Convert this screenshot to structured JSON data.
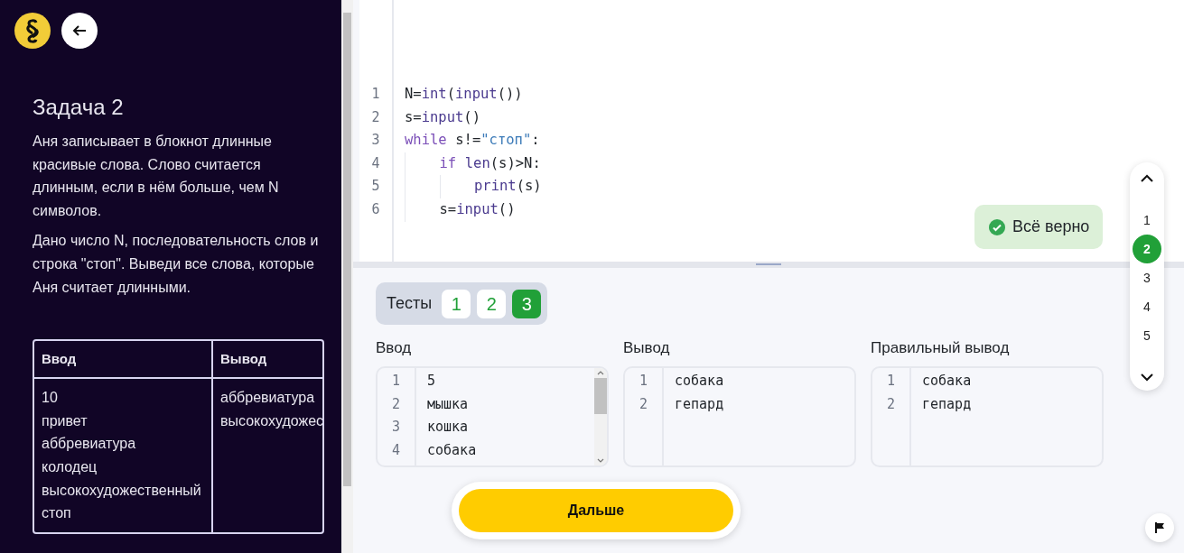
{
  "sidebar": {
    "title": "Задача 2",
    "paragraphs": [
      "Аня записывает в блокнот длинные красивые слова. Слово считается длинным, если в нём больше, чем N символов.",
      "Дано число N, последовательность слов и строка \"стоп\". Выведи все слова, которые Аня считает длинными."
    ],
    "example_table": {
      "columns": [
        "Ввод",
        "Вывод"
      ],
      "rows": [
        [
          [
            "10",
            "привет",
            "аббревиатура",
            "колодец",
            "высокохудожественный",
            "стоп"
          ],
          [
            "аббревиатура",
            "высокохудожес"
          ]
        ]
      ]
    }
  },
  "editor": {
    "lines": [
      {
        "number": "1",
        "tokens": [
          {
            "kind": "plain",
            "text": "N="
          },
          {
            "kind": "builtin",
            "text": "int"
          },
          {
            "kind": "plain",
            "text": "("
          },
          {
            "kind": "builtin",
            "text": "input"
          },
          {
            "kind": "plain",
            "text": "())"
          }
        ]
      },
      {
        "number": "2",
        "tokens": [
          {
            "kind": "plain",
            "text": "s="
          },
          {
            "kind": "builtin",
            "text": "input"
          },
          {
            "kind": "plain",
            "text": "()"
          }
        ]
      },
      {
        "number": "3",
        "tokens": [
          {
            "kind": "keyword",
            "text": "while"
          },
          {
            "kind": "plain",
            "text": "s!=",
            "space_before": true
          },
          {
            "kind": "string",
            "text": "\"стоп\""
          },
          {
            "kind": "plain",
            "text": ":"
          }
        ],
        "children": [
          {
            "number": "4",
            "tokens": [
              {
                "kind": "keyword",
                "text": "if"
              },
              {
                "kind": "builtin",
                "text": "len",
                "space_before": true
              },
              {
                "kind": "plain",
                "text": "(s)>N:"
              }
            ],
            "children": [
              {
                "number": "5",
                "tokens": [
                  {
                    "kind": "builtin",
                    "text": "print"
                  },
                  {
                    "kind": "plain",
                    "text": "(s)"
                  }
                ]
              }
            ]
          },
          {
            "number": "6",
            "tokens": [
              {
                "kind": "plain",
                "text": "s="
              },
              {
                "kind": "builtin",
                "text": "input"
              },
              {
                "kind": "plain",
                "text": "()"
              }
            ]
          }
        ]
      }
    ],
    "status": "Всё верно"
  },
  "task_nav": [
    {
      "label": "1",
      "selected": false
    },
    {
      "label": "2",
      "selected": true
    },
    {
      "label": "3",
      "selected": false
    },
    {
      "label": "4",
      "selected": false
    },
    {
      "label": "5",
      "selected": false
    }
  ],
  "tests": {
    "label": "Тесты",
    "items": [
      {
        "label": "1",
        "selected": false
      },
      {
        "label": "2",
        "selected": false
      },
      {
        "label": "3",
        "selected": true
      }
    ]
  },
  "panels": [
    {
      "title": "Ввод",
      "lines": [
        {
          "number": "1",
          "text": "5"
        },
        {
          "number": "2",
          "text": "мышка"
        },
        {
          "number": "3",
          "text": "кошка"
        },
        {
          "number": "4",
          "text": "собака"
        }
      ],
      "scrollable": true
    },
    {
      "title": "Вывод",
      "lines": [
        {
          "number": "1",
          "text": "собака"
        },
        {
          "number": "2",
          "text": "гепард"
        }
      ],
      "scrollable": false
    },
    {
      "title": "Правильный вывод",
      "lines": [
        {
          "number": "1",
          "text": "собака"
        },
        {
          "number": "2",
          "text": "гепард"
        }
      ],
      "scrollable": false
    }
  ],
  "next_button": "Дальше"
}
